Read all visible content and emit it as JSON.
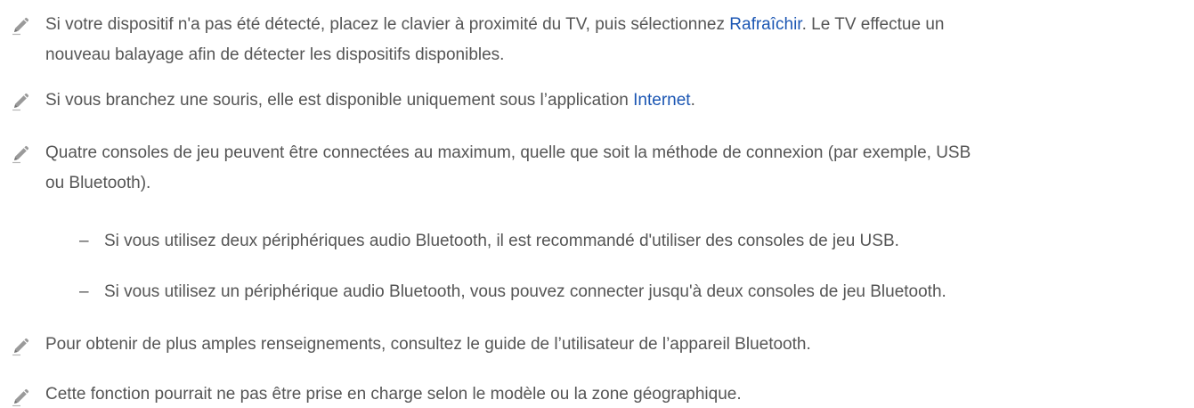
{
  "notes": [
    {
      "line1_before": "Si votre dispositif n'a pas été détecté, placez le clavier à proximité du TV, puis sélectionnez ",
      "line1_link": "Rafraîchir",
      "line1_after": ". Le TV effectue un",
      "line2": "nouveau balayage afin de détecter les dispositifs disponibles."
    },
    {
      "before": "Si vous branchez une souris, elle est disponible uniquement sous l’application ",
      "link": "Internet",
      "after": "."
    },
    {
      "line1": "Quatre consoles de jeu peuvent être connectées au maximum, quelle que soit la méthode de connexion (par exemple, USB",
      "line2": "ou Bluetooth).",
      "sub_items": [
        "Si vous utilisez deux périphériques audio Bluetooth, il est recommandé d'utiliser des consoles de jeu USB.",
        "Si vous utilisez un périphérique audio Bluetooth, vous pouvez connecter jusqu'à deux consoles de jeu Bluetooth."
      ],
      "dash": "–"
    },
    {
      "text": "Pour obtenir de plus amples renseignements, consultez le guide de l’utilisateur de l’appareil Bluetooth."
    },
    {
      "text": "Cette fonction pourrait ne pas être prise en charge selon le modèle ou la zone géographique."
    }
  ],
  "colors": {
    "text": "#555555",
    "link": "#1b56b3",
    "icon": "#8a8a8a"
  },
  "icon": "pencil-icon"
}
